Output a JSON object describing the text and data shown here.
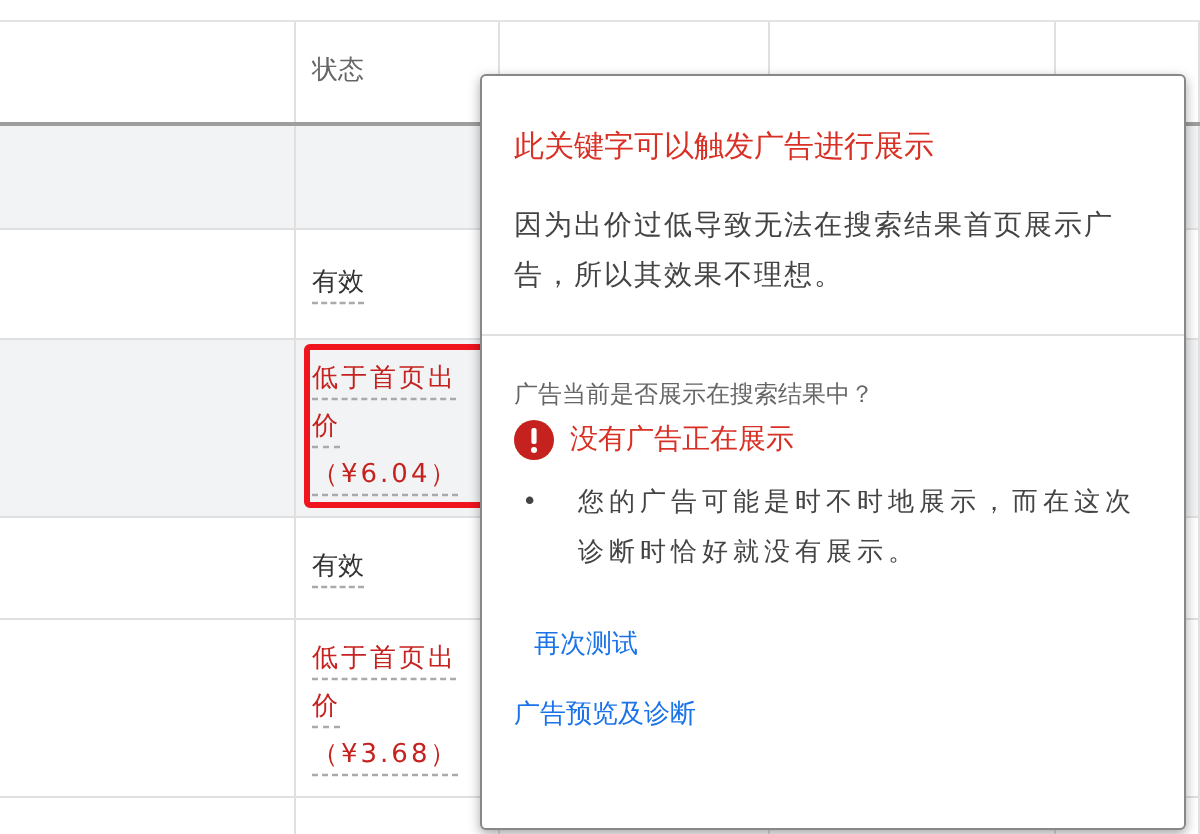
{
  "table": {
    "columns": [
      "",
      "状态",
      "",
      "",
      ""
    ],
    "rows": [
      {
        "shaded": true,
        "outlined": false
      },
      {
        "shaded": false,
        "outlined": false,
        "status": {
          "kind": "valid",
          "text": "有效"
        }
      },
      {
        "shaded": true,
        "outlined": true,
        "status": {
          "kind": "low_bid",
          "text": "低于首页出价",
          "price": "（¥6.04）"
        }
      },
      {
        "shaded": false,
        "outlined": false,
        "status": {
          "kind": "valid",
          "text": "有效"
        }
      },
      {
        "shaded": false,
        "outlined": false,
        "status": {
          "kind": "low_bid",
          "text": "低于首页出价",
          "price": "（¥3.68）"
        }
      },
      {
        "shaded": false,
        "outlined": false
      }
    ]
  },
  "popover": {
    "title": "此关键字可以触发广告进行展示",
    "description": "因为出价过低导致无法在搜索结果首页展示广告，所以其效果不理想。",
    "question": "广告当前是否展示在搜索结果中？",
    "result": {
      "kind": "error",
      "text": "没有广告正在展示"
    },
    "bullets": [
      {
        "marker": "•",
        "text": "您的广告可能是时不时地展示，而在这次诊断时恰好就没有展示。"
      }
    ],
    "links": [
      "再次测试",
      "广告预览及诊断"
    ]
  }
}
